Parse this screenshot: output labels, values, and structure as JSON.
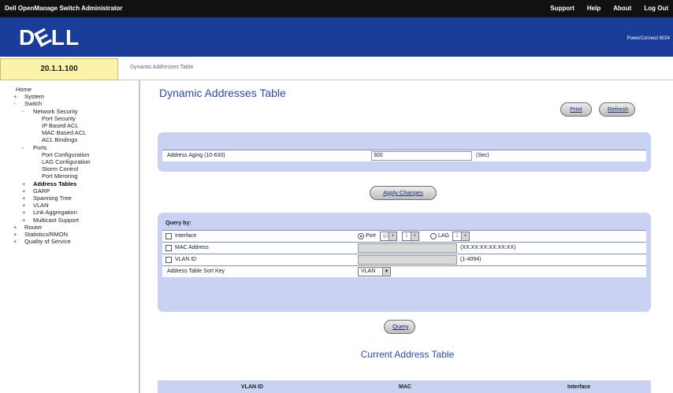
{
  "topbar": {
    "title": "Dell OpenManage Switch Administrator",
    "links": [
      "Support",
      "Help",
      "About",
      "Log Out"
    ]
  },
  "header": {
    "logo": "DELL",
    "product": "PowerConnect 6024"
  },
  "device": {
    "ip": "20.1.1.100"
  },
  "breadcrumb": "Dynamic Addresses Table",
  "sidebar": {
    "items": [
      {
        "expander": "",
        "label": "Home",
        "indent": 0
      },
      {
        "expander": "+",
        "label": "System",
        "indent": 1
      },
      {
        "expander": "-",
        "label": "Switch",
        "indent": 1
      },
      {
        "expander": "-",
        "label": "Network Security",
        "indent": 2
      },
      {
        "expander": "",
        "label": "Port Security",
        "indent": 3
      },
      {
        "expander": "",
        "label": "IP Based ACL",
        "indent": 3
      },
      {
        "expander": "",
        "label": "MAC Based ACL",
        "indent": 3
      },
      {
        "expander": "",
        "label": "ACL Bindings",
        "indent": 3
      },
      {
        "expander": "-",
        "label": "Ports",
        "indent": 2
      },
      {
        "expander": "",
        "label": "Port Configuration",
        "indent": 3
      },
      {
        "expander": "",
        "label": "LAG Configuration",
        "indent": 3
      },
      {
        "expander": "",
        "label": "Storm Control",
        "indent": 3
      },
      {
        "expander": "",
        "label": "Port Mirroring",
        "indent": 3
      },
      {
        "expander": "+",
        "label": "Address Tables",
        "indent": 2,
        "selected": true
      },
      {
        "expander": "+",
        "label": "GARP",
        "indent": 2
      },
      {
        "expander": "+",
        "label": "Spanning Tree",
        "indent": 2
      },
      {
        "expander": "+",
        "label": "VLAN",
        "indent": 2
      },
      {
        "expander": "+",
        "label": "Link Aggregation",
        "indent": 2
      },
      {
        "expander": "+",
        "label": "Multicast Support",
        "indent": 2
      },
      {
        "expander": "+",
        "label": "Router",
        "indent": 1
      },
      {
        "expander": "+",
        "label": "Statistics/RMON",
        "indent": 1
      },
      {
        "expander": "+",
        "label": "Quality of Service",
        "indent": 1
      }
    ]
  },
  "page": {
    "title": "Dynamic Addresses Table",
    "print_label": "Print",
    "refresh_label": "Refresh",
    "aging_label": "Address Aging (10-630)",
    "aging_value": "300",
    "aging_unit": "(Sec)",
    "apply_label": "Apply Changes",
    "query_by_label": "Query by:",
    "interface_label": "Interface",
    "port_label": "Port",
    "port_unit": "g1",
    "port_num": "1",
    "lag_label": "LAG",
    "lag_value": "1",
    "mac_label": "MAC Address",
    "mac_hint": "(XX:XX:XX:XX:XX:XX)",
    "vlan_label": "VLAN ID",
    "vlan_hint": "(1-4094)",
    "sort_label": "Address Table Sort Key",
    "sort_value": "VLAN",
    "query_label": "Query",
    "table_title": "Current Address Table",
    "columns": [
      "VLAN ID",
      "MAC",
      "Interface"
    ]
  },
  "colors": {
    "header_blue": "#1a3d99",
    "panel": "#c9d2f2",
    "title_blue": "#2a4bb0",
    "ip_yellow": "#fbf3a8"
  }
}
